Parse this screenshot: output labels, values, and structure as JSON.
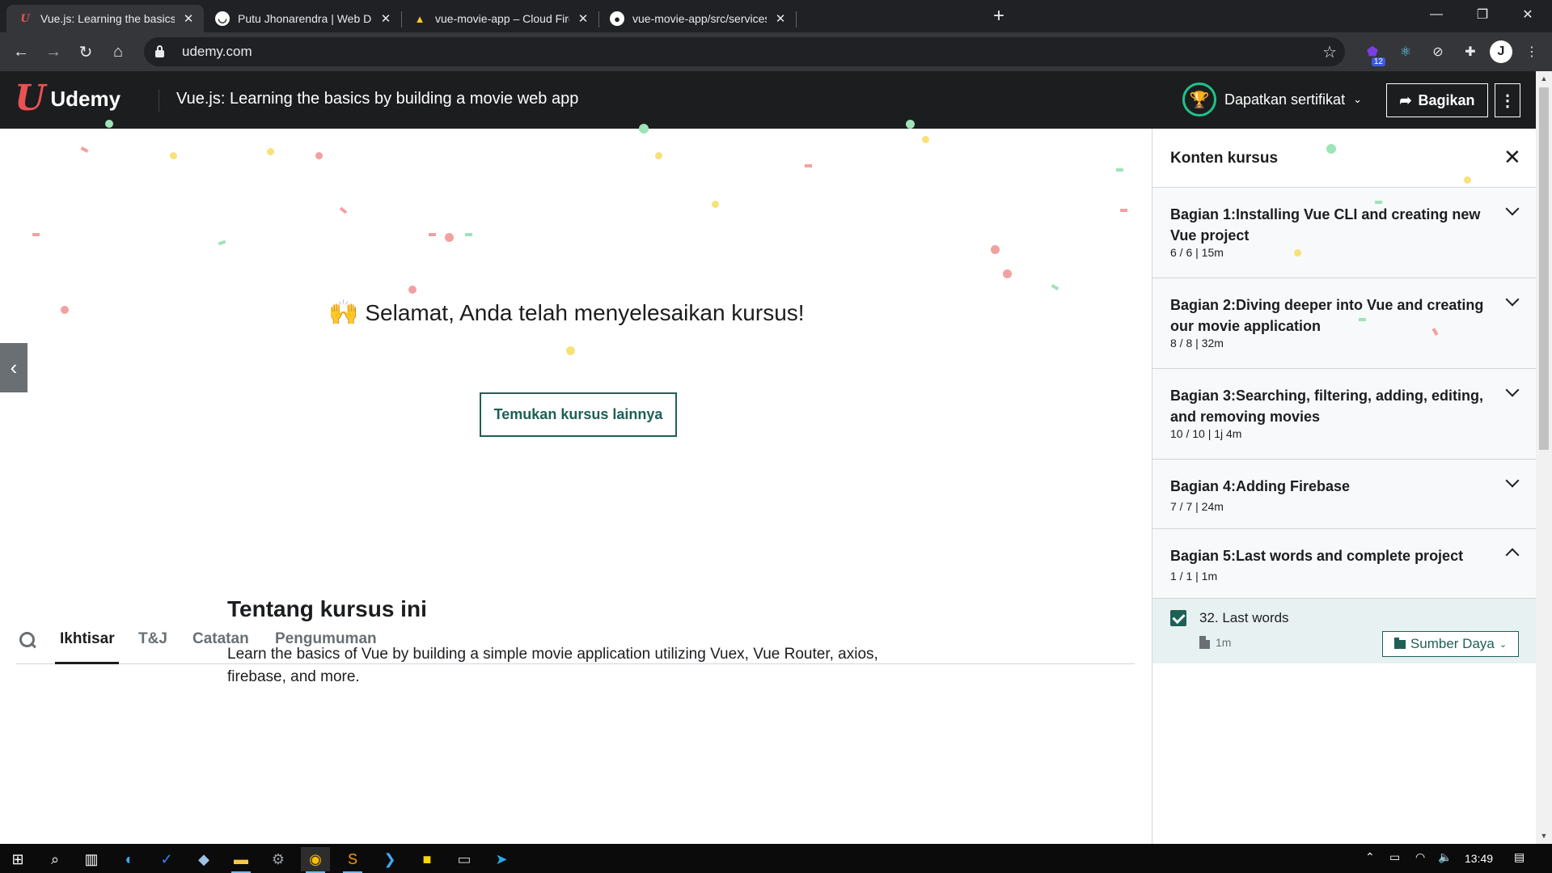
{
  "browser": {
    "tabs": [
      {
        "title": "Vue.js: Learning the basics by bui",
        "favicon": "udemy-favicon"
      },
      {
        "title": "Putu Jhonarendra | Web Develop",
        "favicon": "smile-favicon"
      },
      {
        "title": "vue-movie-app – Cloud Firestore",
        "favicon": "firebase-favicon"
      },
      {
        "title": "vue-movie-app/src/services at m",
        "favicon": "github-favicon"
      }
    ],
    "url": "udemy.com",
    "extension_badge": "12"
  },
  "header": {
    "brand": "Udemy",
    "course_title": "Vue.js: Learning the basics by building a movie web app",
    "certificate_label": "Dapatkan sertifikat",
    "share_label": "Bagikan"
  },
  "main": {
    "congrats_emoji": "🙌",
    "congrats_text": "Selamat, Anda telah menyelesaikan kursus!",
    "find_more_label": "Temukan kursus lainnya",
    "tabs": [
      {
        "label": "Ikhtisar"
      },
      {
        "label": "T&J"
      },
      {
        "label": "Catatan"
      },
      {
        "label": "Pengumuman"
      }
    ],
    "about_title": "Tentang kursus ini",
    "about_text": "Learn the basics of Vue by building a simple movie application utilizing Vuex, Vue Router, axios, firebase, and more."
  },
  "sidebar": {
    "title": "Konten kursus",
    "sections": [
      {
        "title": "Bagian 1:Installing Vue CLI and creating new Vue project",
        "meta": "6 / 6 | 15m",
        "expanded": false
      },
      {
        "title": "Bagian 2:Diving deeper into Vue and creating our movie application",
        "meta": "8 / 8 | 32m",
        "expanded": false
      },
      {
        "title": "Bagian 3:Searching, filtering, adding, editing, and removing movies",
        "meta": "10 / 10 | 1j 4m",
        "expanded": false
      },
      {
        "title": "Bagian 4:Adding Firebase",
        "meta": "7 / 7 | 24m",
        "expanded": false
      },
      {
        "title": "Bagian 5:Last words and complete project",
        "meta": "1 / 1 | 1m",
        "expanded": true
      }
    ],
    "lecture": {
      "title": "32. Last words",
      "duration": "1m",
      "resources_label": "Sumber Daya",
      "completed": true
    }
  },
  "taskbar": {
    "clock": "13:49"
  },
  "colors": {
    "accent": "#1e6055",
    "header_bg": "#1c1d1f",
    "udemy_red": "#ea5252",
    "trophy_green": "#1ec28b"
  }
}
